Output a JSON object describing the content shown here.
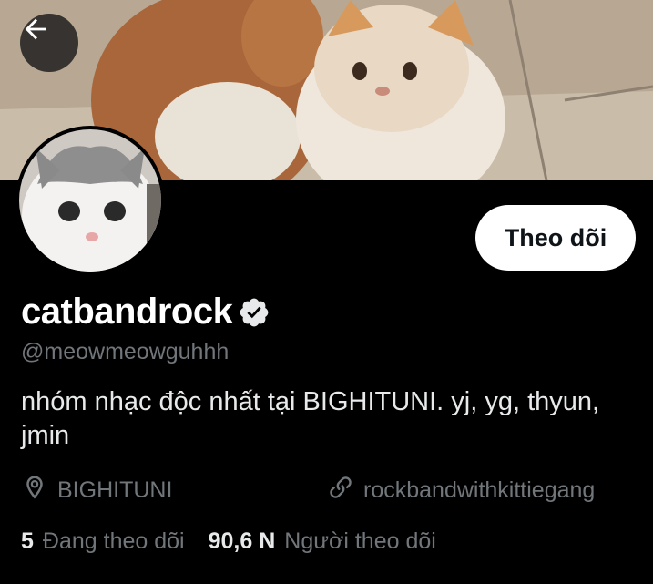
{
  "header": {
    "back_icon": "arrow-left-icon"
  },
  "profile": {
    "display_name": "catbandrock",
    "verified_icon": "verified-badge-icon",
    "handle": "@meowmeowguhhh",
    "bio": "nhóm nhạc độc nhất tại BIGHITUNI. yj, yg, thyun, jmin",
    "follow_label": "Theo dõi",
    "location_icon": "location-pin-icon",
    "location": "BIGHITUNI",
    "link_icon": "link-icon",
    "url": "rockbandwithkittiegang",
    "following_count": "5",
    "following_label": "Đang theo dõi",
    "followers_count": "90,6 N",
    "followers_label": "Người theo dõi"
  },
  "colors": {
    "background": "#000000",
    "secondary_text": "#71767b",
    "primary_text": "#e7e9ea",
    "button_bg": "#ffffff"
  }
}
